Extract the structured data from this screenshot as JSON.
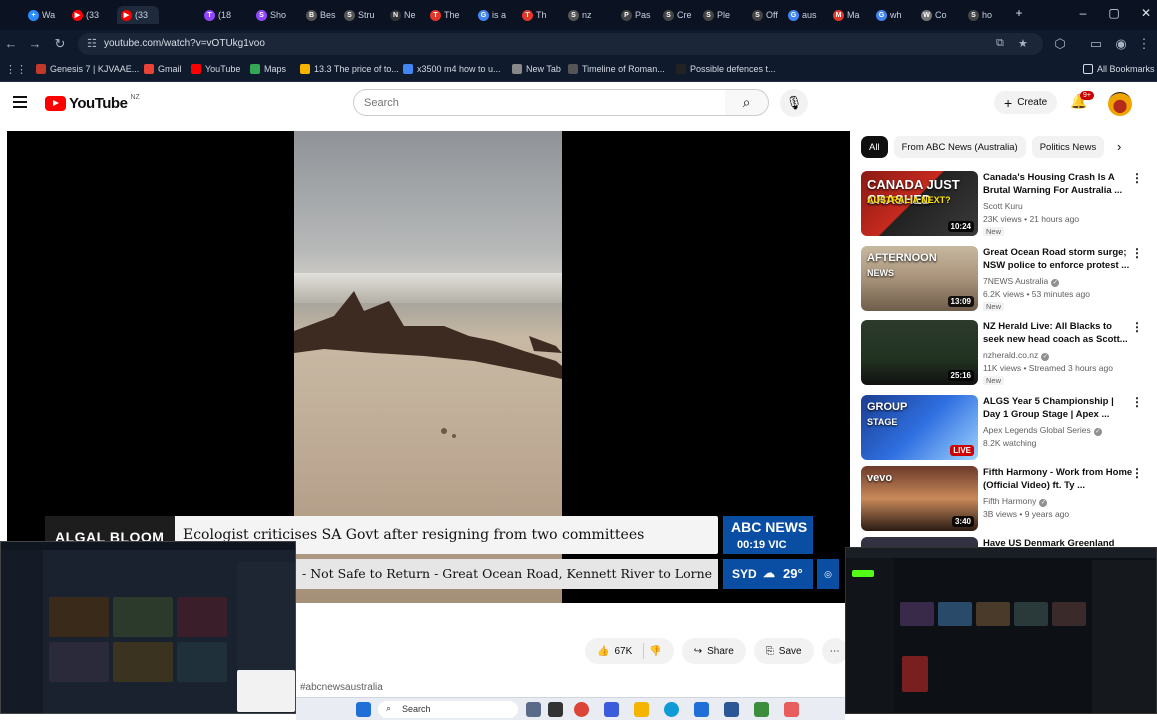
{
  "browser": {
    "tabs": [
      {
        "label": "Wa",
        "color": "#2a8cff",
        "glyph": "+"
      },
      {
        "label": "(33",
        "color": "#ff0000",
        "glyph": "▶"
      },
      {
        "label": "(33",
        "color": "#ff0000",
        "glyph": "▶"
      },
      {
        "label": "(18",
        "color": "#9146ff",
        "glyph": "T"
      },
      {
        "label": "Sho",
        "color": "#9146ff",
        "glyph": "S"
      },
      {
        "label": "Bes",
        "color": "#555555",
        "glyph": "B"
      },
      {
        "label": "Stru",
        "color": "#555555",
        "glyph": "S"
      },
      {
        "label": "Ne",
        "color": "#333333",
        "glyph": "N"
      },
      {
        "label": "The",
        "color": "#e0382b",
        "glyph": "T"
      },
      {
        "label": "is a",
        "color": "#4285f4",
        "glyph": "G"
      },
      {
        "label": "Th",
        "color": "#e0382b",
        "glyph": "T"
      },
      {
        "label": "nz",
        "color": "#555555",
        "glyph": "S"
      },
      {
        "label": "Pas",
        "color": "#444444",
        "glyph": "P"
      },
      {
        "label": "Cre",
        "color": "#444444",
        "glyph": "S"
      },
      {
        "label": "Ple",
        "color": "#444444",
        "glyph": "S"
      },
      {
        "label": "Off",
        "color": "#444444",
        "glyph": "S"
      },
      {
        "label": "aus",
        "color": "#4285f4",
        "glyph": "G"
      },
      {
        "label": "Ma",
        "color": "#e0382b",
        "glyph": "M"
      },
      {
        "label": "wh",
        "color": "#4285f4",
        "glyph": "G"
      },
      {
        "label": "Co",
        "color": "#777777",
        "glyph": "W"
      },
      {
        "label": "ho",
        "color": "#444444",
        "glyph": "S"
      }
    ],
    "url": "youtube.com/watch?v=vOTUkg1voo",
    "bookmarks": [
      {
        "label": "Genesis 7 | KJVAAE...",
        "color": "#c0392b"
      },
      {
        "label": "Gmail",
        "color": "#ea4335"
      },
      {
        "label": "YouTube",
        "color": "#ff0000"
      },
      {
        "label": "Maps",
        "color": "#34a853"
      },
      {
        "label": "13.3 The price of to...",
        "color": "#f4b400"
      },
      {
        "label": "x3500 m4 how to u...",
        "color": "#4285f4"
      },
      {
        "label": "New Tab",
        "color": "#888888"
      },
      {
        "label": "Timeline of Roman...",
        "color": "#555555"
      },
      {
        "label": "Possible defences t...",
        "color": "#222222"
      }
    ],
    "all_bookmarks": "All Bookmarks"
  },
  "youtube": {
    "logo_text": "YouTube",
    "country_code": "NZ",
    "search_placeholder": "Search",
    "create_label": "Create",
    "notif_count": "9+",
    "chips": [
      "All",
      "From ABC News (Australia)",
      "Politics News"
    ],
    "like_count": "67K",
    "share_label": "Share",
    "save_label": "Save",
    "hashtag": "#abcnewsaustralia"
  },
  "video": {
    "chyron_tag": "ALGAL BLOOM",
    "chyron_headline": "Ecologist criticises SA Govt after resigning from two committees",
    "chyron_ticker": "- Not Safe to Return - Great Ocean Road, Kennett River to Lorne",
    "brand": "ABC NEWS",
    "time": "00:19 VIC",
    "city": "SYD",
    "temp": "29°"
  },
  "recommendations": [
    {
      "title": "Canada's Housing Crash Is A Brutal Warning For Australia ...",
      "channel": "Scott Kuru",
      "verified": false,
      "meta": "23K views • 21 hours ago",
      "badge": "New",
      "duration": "10:24",
      "thumb_text": "CANADA JUST CRASHED",
      "thumb_sub": "AUSTRALIA NEXT?"
    },
    {
      "title": "Great Ocean Road storm surge; NSW police to enforce protest ...",
      "channel": "7NEWS Australia",
      "verified": true,
      "meta": "6.2K views • 53 minutes ago",
      "badge": "New",
      "duration": "13:09",
      "thumb_text": "AFTERNOON",
      "thumb_sub": "NEWS"
    },
    {
      "title": "NZ Herald Live: All Blacks to seek new head coach as Scott...",
      "channel": "nzherald.co.nz",
      "verified": true,
      "meta": "11K views • Streamed 3 hours ago",
      "badge": "New",
      "duration": "25:16",
      "thumb_text": "",
      "thumb_sub": ""
    },
    {
      "title": "ALGS Year 5 Championship | Day 1 Group Stage | Apex ...",
      "channel": "Apex Legends Global Series",
      "verified": true,
      "meta": "8.2K watching",
      "badge": "",
      "duration": "LIVE",
      "thumb_text": "GROUP",
      "thumb_sub": "STAGE"
    },
    {
      "title": "Fifth Harmony - Work from Home (Official Video) ft. Ty ...",
      "channel": "Fifth Harmony",
      "verified": true,
      "meta": "3B views • 9 years ago",
      "badge": "",
      "duration": "3:40",
      "thumb_text": "vevo",
      "thumb_sub": ""
    },
    {
      "title": "Have US Denmark Greenland",
      "channel": "",
      "verified": false,
      "meta": "",
      "badge": "",
      "duration": "",
      "thumb_text": "",
      "thumb_sub": ""
    }
  ],
  "taskbar": {
    "search_label": "Search"
  },
  "colors": {
    "accent_red": "#ff0000",
    "abc_blue": "#0a4ea3"
  }
}
